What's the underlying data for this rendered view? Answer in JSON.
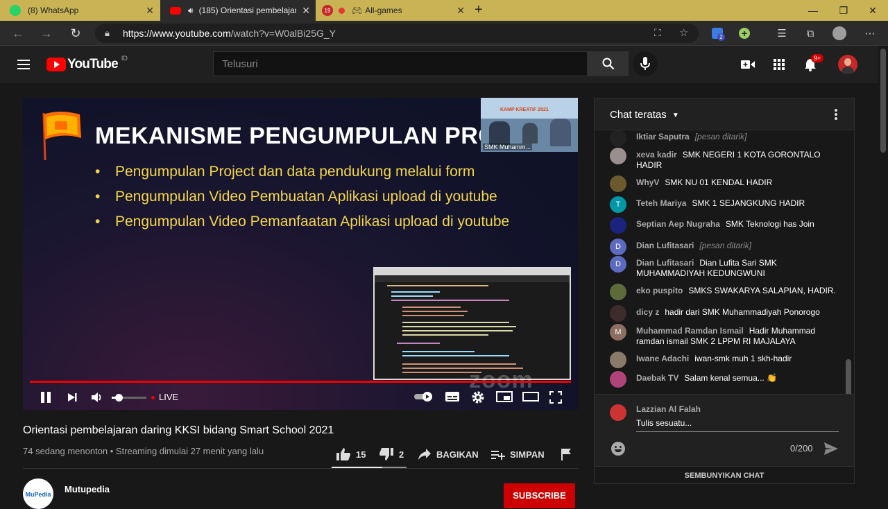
{
  "browser": {
    "tabs": [
      {
        "title": "(8) WhatsApp",
        "close": "✕",
        "fav_color": "#25D366"
      },
      {
        "title": "(185) Orientasi pembelajara",
        "close": "✕",
        "fav_color": "#ff0000"
      },
      {
        "title": "All-games",
        "close": "✕",
        "fav_color": "#c62828",
        "badge": "19"
      }
    ],
    "new_tab": "+",
    "url_host": "https://www.youtube.com",
    "url_path": "/watch?v=W0alBi25G_Y",
    "extension_badge": "2"
  },
  "youtube": {
    "logo_text": "YouTube",
    "region": "ID",
    "search_placeholder": "Telusuri",
    "notification_count": "9+"
  },
  "player": {
    "slide_title": "MEKANISME PENGUMPULAN PRO",
    "bullets": [
      "Pengumpulan Project dan data pendukung melalui form",
      "Pengumpulan Video Pembuatan Aplikasi upload di youtube",
      "Pengumpulan Video Pemanfaatan Aplikasi upload di youtube"
    ],
    "zoom_thumb_title": "KAMP KREATIF 2021",
    "zoom_thumb_name": "SMK Muhamm...",
    "zoom_watermark": "zoom",
    "live_label": "LIVE",
    "volume_fraction": 0.15
  },
  "video": {
    "title": "Orientasi pembelajaran daring KKSI bidang Smart School 2021",
    "meta": "74 sedang menonton • Streaming dimulai 27 menit yang lalu",
    "likes": "15",
    "dislikes": "2",
    "share_label": "BAGIKAN",
    "save_label": "SIMPAN",
    "channel_name": "Mutupedia",
    "channel_logo_text": "MuPedia",
    "subscribe_label": "SUBSCRIBE"
  },
  "chat": {
    "title": "Chat teratas",
    "messages": [
      {
        "name": "Iktiar Saputra",
        "text": "",
        "deleted": "[pesan ditarik]",
        "avatar": "",
        "avatar_color": "#222222"
      },
      {
        "name": "xeva kadir",
        "text": "SMK NEGERI 1 KOTA GORONTALO HADIR",
        "deleted": "",
        "avatar": "",
        "avatar_color": "#9a8f8f"
      },
      {
        "name": "WhyV",
        "text": "SMK NU 01 KENDAL HADIR",
        "deleted": "",
        "avatar": "",
        "avatar_color": "#6b5a2e"
      },
      {
        "name": "Teteh Mariya",
        "text": "SMK 1 SEJANGKUNG HADIR",
        "deleted": "",
        "avatar": "T",
        "avatar_color": "#0097a7"
      },
      {
        "name": "Septian Aep Nugraha",
        "text": "SMK Teknologi has Join",
        "deleted": "",
        "avatar": "",
        "avatar_color": "#1a237e"
      },
      {
        "name": "Dian Lufitasari",
        "text": "",
        "deleted": "[pesan ditarik]",
        "avatar": "D",
        "avatar_color": "#5c6bc0"
      },
      {
        "name": "Dian Lufitasari",
        "text": "Dian Lufita Sari SMK MUHAMMADIYAH KEDUNGWUNI",
        "deleted": "",
        "avatar": "D",
        "avatar_color": "#5c6bc0"
      },
      {
        "name": "eko puspito",
        "text": "SMKS SWAKARYA SALAPIAN, HADIR.",
        "deleted": "",
        "avatar": "",
        "avatar_color": "#5d6b3a"
      },
      {
        "name": "dicy z",
        "text": "hadir dari SMK Muhammadiyah Ponorogo",
        "deleted": "",
        "avatar": "",
        "avatar_color": "#3e2b2b"
      },
      {
        "name": "Muhammad Ramdan Ismail",
        "text": "Hadir Muhammad ramdan ismail SMK 2 LPPM RI MAJALAYA",
        "deleted": "",
        "avatar": "M",
        "avatar_color": "#8d6e63"
      },
      {
        "name": "Iwane Adachi",
        "text": "iwan-smk muh 1 skh-hadir",
        "deleted": "",
        "avatar": "",
        "avatar_color": "#8a7a6a"
      },
      {
        "name": "Daebak TV",
        "text": "Salam kenal semua... 👏",
        "deleted": "",
        "avatar": "",
        "avatar_color": "#b0447a"
      }
    ],
    "my_name": "Lazzian Al Falah",
    "input_placeholder": "Tulis sesuatu...",
    "counter": "0/200",
    "hide_label": "SEMBUNYIKAN CHAT"
  }
}
